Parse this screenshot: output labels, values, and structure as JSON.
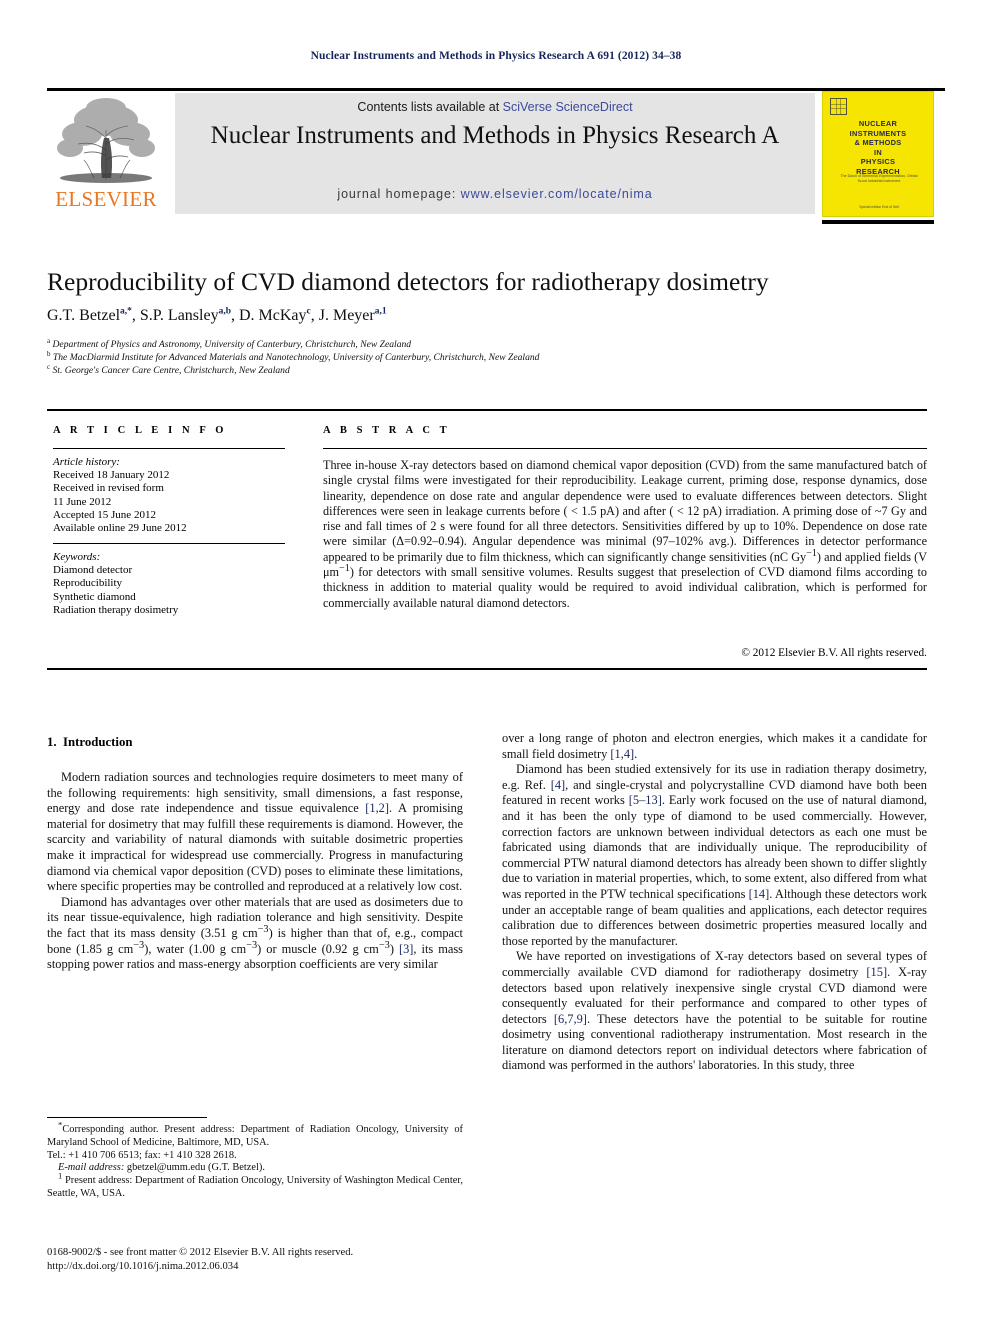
{
  "running_head": "Nuclear Instruments and Methods in Physics Research A 691 (2012) 34–38",
  "masthead": {
    "contents_prefix": "Contents lists available at ",
    "sciencedirect": "SciVerse ScienceDirect",
    "journal_title": "Nuclear Instruments and Methods in Physics Research A",
    "homepage_prefix": "journal homepage: ",
    "homepage_url": "www.elsevier.com/locate/nima",
    "publisher_wordmark": "ELSEVIER",
    "publisher_accent_color": "#e87722",
    "link_color": "#3b4a9b",
    "band_color": "#e4e4e4"
  },
  "cover": {
    "title_lines": [
      "NUCLEAR",
      "INSTRUMENTS",
      "& METHODS",
      "IN",
      "PHYSICS",
      "RESEARCH"
    ],
    "subtitle": "The Dutch of Elemental Experimentation, Orbital Scout Industrial Instrument",
    "footer": "Special edition End of Self",
    "background_color": "#f5e500"
  },
  "article": {
    "title": "Reproducibility of CVD diamond detectors for radiotherapy dosimetry",
    "authors": [
      {
        "name": "G.T. Betzel",
        "marks": "a,*"
      },
      {
        "name": "S.P. Lansley",
        "marks": "a,b"
      },
      {
        "name": "D. McKay",
        "marks": "c"
      },
      {
        "name": "J. Meyer",
        "marks": "a,1"
      }
    ],
    "affiliations": [
      {
        "mark": "a",
        "text": "Department of Physics and Astronomy, University of Canterbury, Christchurch, New Zealand"
      },
      {
        "mark": "b",
        "text": "The MacDiarmid Institute for Advanced Materials and Nanotechnology, University of Canterbury, Christchurch, New Zealand"
      },
      {
        "mark": "c",
        "text": "St. George's Cancer Care Centre, Christchurch, New Zealand"
      }
    ]
  },
  "info_panel": {
    "heading": "A R T I C L E   I N F O",
    "history_label": "Article history:",
    "history": [
      "Received 18 January 2012",
      "Received in revised form",
      "11 June 2012",
      "Accepted 15 June 2012",
      "Available online 29 June 2012"
    ],
    "keywords_label": "Keywords:",
    "keywords": [
      "Diamond detector",
      "Reproducibility",
      "Synthetic diamond",
      "Radiation therapy dosimetry"
    ]
  },
  "abstract_panel": {
    "heading": "A B S T R A C T",
    "text": "Three in-house X-ray detectors based on diamond chemical vapor deposition (CVD) from the same manufactured batch of single crystal films were investigated for their reproducibility. Leakage current, priming dose, response dynamics, dose linearity, dependence on dose rate and angular dependence were used to evaluate differences between detectors. Slight differences were seen in leakage currents before ( < 1.5 pA) and after ( < 12 pA) irradiation. A priming dose of ~7 Gy and rise and fall times of 2 s were found for all three detectors. Sensitivities differed by up to 10%. Dependence on dose rate were similar (Δ=0.92–0.94). Angular dependence was minimal (97–102% avg.). Differences in detector performance appeared to be primarily due to film thickness, which can significantly change sensitivities (nC Gy−1) and applied fields (V μm−1) for detectors with small sensitive volumes. Results suggest that preselection of CVD diamond films according to thickness in addition to material quality would be required to avoid individual calibration, which is performed for commercially available natural diamond detectors.",
    "copyright": "© 2012 Elsevier B.V. All rights reserved."
  },
  "body": {
    "section_number": "1.",
    "section_title": "Introduction",
    "left_paragraphs": [
      "Modern radiation sources and technologies require dosimeters to meet many of the following requirements: high sensitivity, small dimensions, a fast response, energy and dose rate independence and tissue equivalence [1,2]. A promising material for dosimetry that may fulfill these requirements is diamond. However, the scarcity and variability of natural diamonds with suitable dosimetric properties make it impractical for widespread use commercially. Progress in manufacturing diamond via chemical vapor deposition (CVD) poses to eliminate these limitations, where specific properties may be controlled and reproduced at a relatively low cost.",
      "Diamond has advantages over other materials that are used as dosimeters due to its near tissue-equivalence, high radiation tolerance and high sensitivity. Despite the fact that its mass density (3.51 g cm−3) is higher than that of, e.g., compact bone (1.85 g cm−3), water (1.00 g cm−3) or muscle (0.92 g cm−3) [3], its mass stopping power ratios and mass-energy absorption coefficients are very similar"
    ],
    "right_paragraphs": [
      "over a long range of photon and electron energies, which makes it a candidate for small field dosimetry [1,4].",
      "Diamond has been studied extensively for its use in radiation therapy dosimetry, e.g. Ref. [4], and single-crystal and polycrystalline CVD diamond have both been featured in recent works [5–13]. Early work focused on the use of natural diamond, and it has been the only type of diamond to be used commercially. However, correction factors are unknown between individual detectors as each one must be fabricated using diamonds that are individually unique. The reproducibility of commercial PTW natural diamond detectors has already been shown to differ slightly due to variation in material properties, which, to some extent, also differed from what was reported in the PTW technical specifications [14]. Although these detectors work under an acceptable range of beam qualities and applications, each detector requires calibration due to differences between dosimetric properties measured locally and those reported by the manufacturer.",
      "We have reported on investigations of X-ray detectors based on several types of commercially available CVD diamond for radiotherapy dosimetry [15]. X-ray detectors based upon relatively inexpensive single crystal CVD diamond were consequently evaluated for their performance and compared to other types of detectors [6,7,9]. These detectors have the potential to be suitable for routine dosimetry using conventional radiotherapy instrumentation. Most research in the literature on diamond detectors report on individual detectors where fabrication of diamond was performed in the authors' laboratories. In this study, three"
    ]
  },
  "footnotes": {
    "corresponding": "Corresponding author. Present address: Department of Radiation Oncology, University of Maryland School of Medicine, Baltimore, MD, USA.",
    "tel": "Tel.: +1 410 706 6513; fax: +1 410 328 2618.",
    "email_label": "E-mail address:",
    "email": "gbetzel@umm.edu (G.T. Betzel).",
    "present_address": "Present address: Department of Radiation Oncology, University of Washington Medical Center, Seattle, WA, USA.",
    "present_address_mark": "1"
  },
  "imprint": {
    "issn_line": "0168-9002/$ - see front matter © 2012 Elsevier B.V. All rights reserved.",
    "doi_line": "http://dx.doi.org/10.1016/j.nima.2012.06.034"
  }
}
